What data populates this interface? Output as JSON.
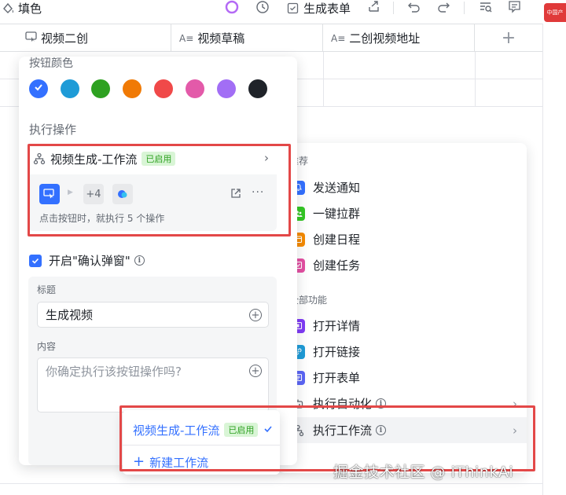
{
  "toolbar": {
    "fill_label": "填色",
    "generate_form_label": "生成表单",
    "badge_text": "中国产"
  },
  "columns": [
    {
      "label": "视频二创",
      "icon": "button-field-icon"
    },
    {
      "label": "视频草稿",
      "icon": "text-field-icon"
    },
    {
      "label": "二创视频地址",
      "icon": "text-field-icon"
    }
  ],
  "button_config": {
    "color_label": "按钮颜色",
    "colors": [
      "#3370ff",
      "#1e9bd7",
      "#2ea121",
      "#f07a05",
      "#f04949",
      "#e35aa9",
      "#a26ef5",
      "#1f2329"
    ],
    "selected_color_index": 0,
    "action_label": "执行操作",
    "workflow": {
      "name": "视频生成-工作流",
      "status": "已启用",
      "extra_count": "+4",
      "note": "点击按钮时，就执行 5 个操作"
    },
    "confirm_label": "开启\"确认弹窗\"",
    "confirm_checked": true,
    "title_label": "标题",
    "title_value": "生成视频",
    "content_label": "内容",
    "content_placeholder": "你确定执行该按钮操作吗?"
  },
  "action_menu": {
    "recommend_label": "推荐",
    "recommend_items": [
      {
        "label": "发送通知",
        "icon": "bell-icon",
        "color": "#3370ff"
      },
      {
        "label": "一键拉群",
        "icon": "group-icon",
        "color": "#34c724"
      },
      {
        "label": "创建日程",
        "icon": "calendar-icon",
        "color": "#f58a00"
      },
      {
        "label": "创建任务",
        "icon": "task-icon",
        "color": "#e34fa2"
      }
    ],
    "all_label": "全部功能",
    "all_items": [
      {
        "label": "打开详情",
        "icon": "detail-icon",
        "color": "#7f3bf5"
      },
      {
        "label": "打开链接",
        "icon": "link-icon",
        "color": "#1e9bd7"
      },
      {
        "label": "打开表单",
        "icon": "form-icon",
        "color": "#5b65f5"
      },
      {
        "label": "执行自动化",
        "icon": "robot-icon",
        "color": "#646a73"
      },
      {
        "label": "执行工作流",
        "icon": "workflow-icon",
        "color": "#646a73"
      }
    ]
  },
  "workflow_dropdown": {
    "item_name": "视频生成-工作流",
    "item_status": "已启用",
    "new_label": "新建工作流"
  },
  "watermark": "掘金技术社区 @ iThinkAi"
}
